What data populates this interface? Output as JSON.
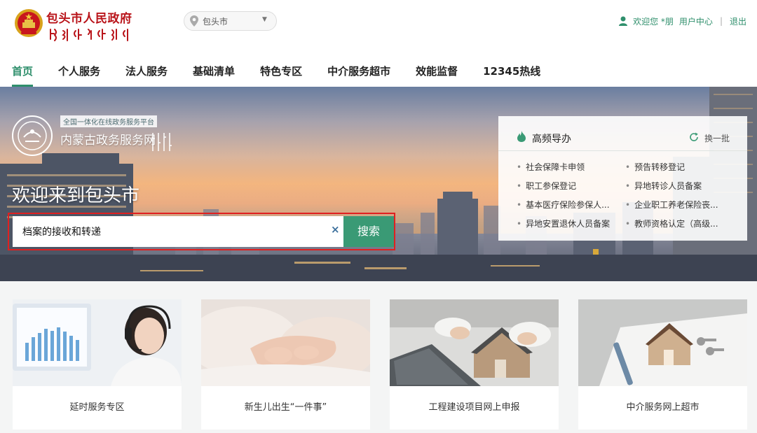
{
  "header": {
    "site_title": "包头市人民政府",
    "location": "包头市",
    "user": {
      "welcome": "欢迎您 *朋",
      "center": "用户中心",
      "separator": "|",
      "logout": "退出"
    }
  },
  "nav": {
    "items": [
      {
        "label": "首页",
        "active": true
      },
      {
        "label": "个人服务"
      },
      {
        "label": "法人服务"
      },
      {
        "label": "基础清单"
      },
      {
        "label": "特色专区"
      },
      {
        "label": "中介服务超市"
      },
      {
        "label": "效能监督"
      },
      {
        "label": "12345热线"
      }
    ]
  },
  "banner": {
    "platform_tag": "全国一体化在线政务服务平台",
    "platform_name": "内蒙古政务服务网",
    "welcome": "欢迎来到包头市",
    "search": {
      "value": "档案的接收和转递",
      "clear": "×",
      "button": "搜索"
    }
  },
  "high_frequency": {
    "title": "高频导办",
    "refresh": "换一批",
    "items": [
      "社会保障卡申领",
      "预告转移登记",
      "职工参保登记",
      "异地转诊人员备案",
      "基本医疗保险参保人...",
      "企业职工养老保险丧...",
      "异地安置退休人员备案",
      "教师资格认定（高级..."
    ]
  },
  "cards": [
    {
      "label": "延时服务专区"
    },
    {
      "label": "新生儿出生“一件事”"
    },
    {
      "label": "工程建设项目网上申报"
    },
    {
      "label": "中介服务网上超市"
    }
  ],
  "colors": {
    "accent": "#2f8f6c",
    "search_button": "#3a9a75",
    "highlight_border": "#e02020",
    "site_title": "#b9141a"
  }
}
